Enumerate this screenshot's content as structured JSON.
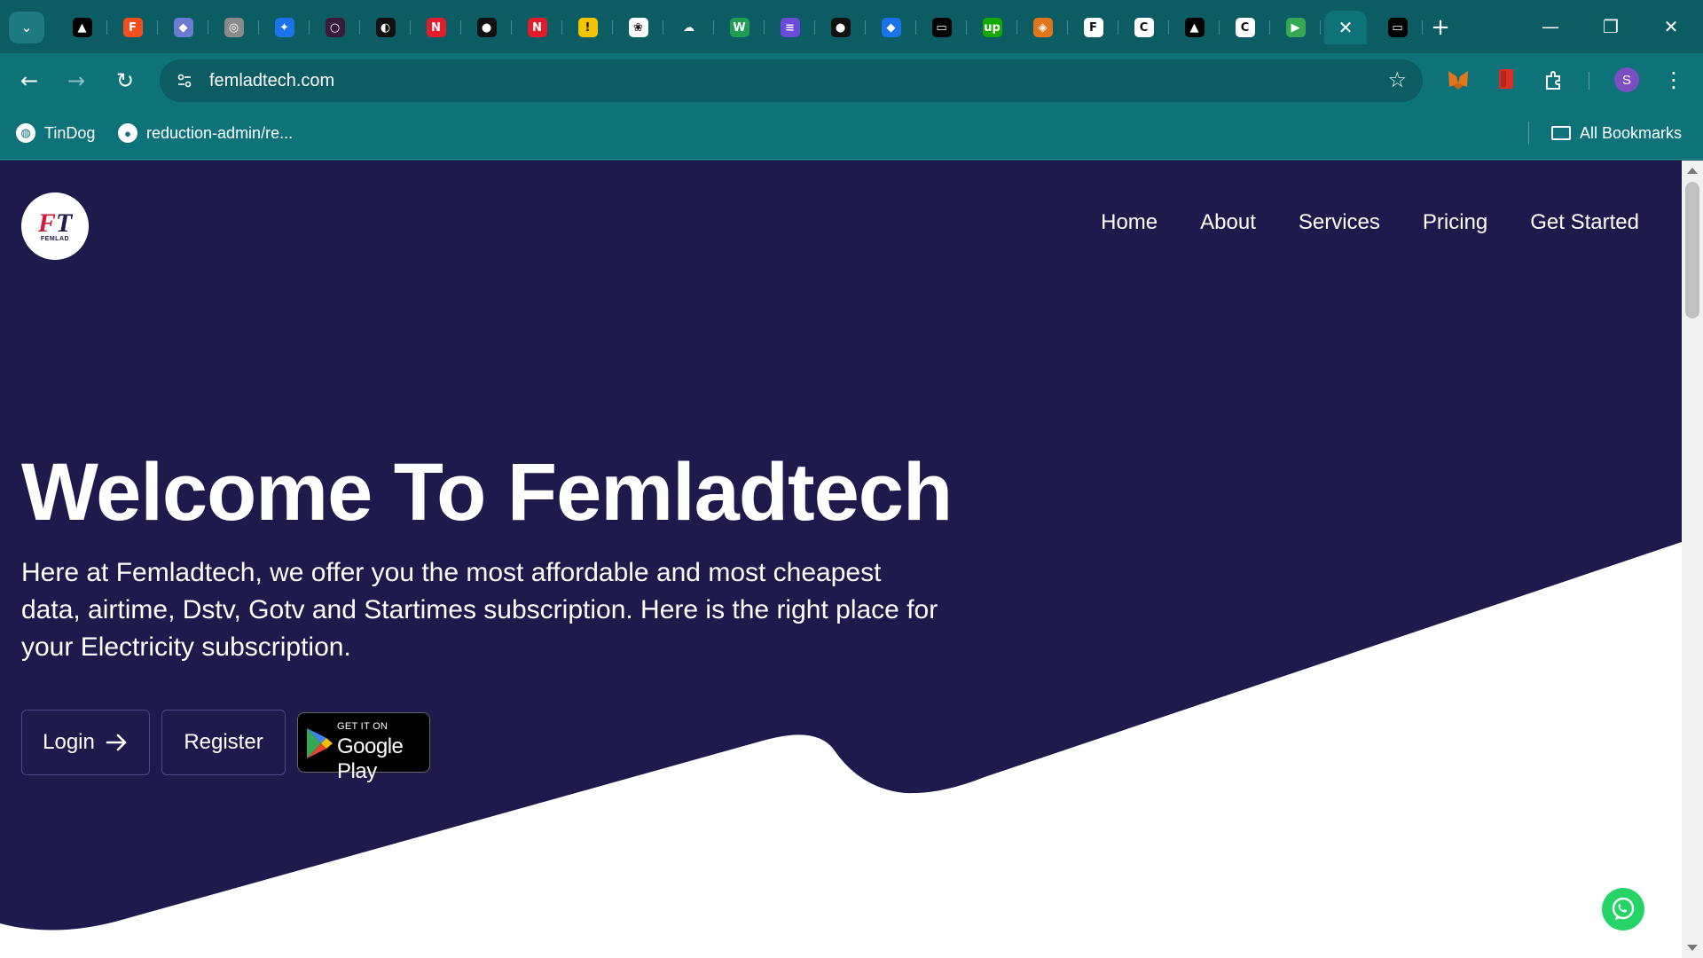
{
  "browser": {
    "tabs": [
      {
        "icon": "vercel-icon",
        "color": "#000000",
        "glyph": "▲"
      },
      {
        "icon": "figma-icon",
        "color": "#f24e1e",
        "glyph": "F"
      },
      {
        "icon": "ethereum-icon",
        "color": "#6a7bd1",
        "glyph": "◆"
      },
      {
        "icon": "globe-icon",
        "color": "#8a8a8a",
        "glyph": "◎"
      },
      {
        "icon": "sparkle-icon",
        "color": "#1a73e8",
        "glyph": "✦"
      },
      {
        "icon": "github-dark-icon",
        "color": "#3a1a3a",
        "glyph": "○"
      },
      {
        "icon": "chart-icon",
        "color": "#111111",
        "glyph": "◐"
      },
      {
        "icon": "n-red-icon",
        "color": "#e11d2b",
        "glyph": "N"
      },
      {
        "icon": "github-icon",
        "color": "#111111",
        "glyph": "●"
      },
      {
        "icon": "n-red-icon",
        "color": "#e11d2b",
        "glyph": "N"
      },
      {
        "icon": "warning-icon",
        "color": "#f5c400",
        "glyph": "!"
      },
      {
        "icon": "openai-icon",
        "color": "#ffffff",
        "glyph": "❀"
      },
      {
        "icon": "cloud-icon",
        "color": "#0b5c63",
        "glyph": "☁"
      },
      {
        "icon": "webflow-icon",
        "color": "#1f9d55",
        "glyph": "W"
      },
      {
        "icon": "list-icon",
        "color": "#6d4bd8",
        "glyph": "≡"
      },
      {
        "icon": "github-icon",
        "color": "#111111",
        "glyph": "●"
      },
      {
        "icon": "diamond-icon",
        "color": "#1a73e8",
        "glyph": "◆"
      },
      {
        "icon": "terminal-icon",
        "color": "#000000",
        "glyph": "▭"
      },
      {
        "icon": "upwork-icon",
        "color": "#14a800",
        "glyph": "up"
      },
      {
        "icon": "metamask-icon",
        "color": "#e2761b",
        "glyph": "◈"
      },
      {
        "icon": "femlad-icon",
        "color": "#ffffff",
        "glyph": "F"
      },
      {
        "icon": "c-circle-icon",
        "color": "#ffffff",
        "glyph": "C"
      },
      {
        "icon": "vercel-icon",
        "color": "#000000",
        "glyph": "▲"
      },
      {
        "icon": "c-circle-icon",
        "color": "#ffffff",
        "glyph": "C"
      },
      {
        "icon": "google-play-icon",
        "color": "#34a853",
        "glyph": "▶"
      }
    ],
    "active_tab_close": "✕",
    "extra_tab": {
      "icon": "terminal-icon",
      "color": "#000000",
      "glyph": "▭"
    },
    "new_tab": "+",
    "url": "femladtech.com",
    "profile_initial": "S",
    "bookmarks": [
      {
        "label": "TinDog",
        "icon": "globe-icon"
      },
      {
        "label": "reduction-admin/re...",
        "icon": "github-icon"
      }
    ],
    "all_bookmarks": "All Bookmarks"
  },
  "page": {
    "colors": {
      "background": "#1e1a4c",
      "wave": "#ffffff"
    },
    "logo": {
      "mark_a": "F",
      "mark_b": "T",
      "text": "FEMLAD"
    },
    "nav": [
      "Home",
      "About",
      "Services",
      "Pricing",
      "Get Started"
    ],
    "hero": {
      "title": "Welcome To Femladtech",
      "text": "Here at Femladtech, we offer you the most affordable and most cheapest data, airtime, Dstv, Gotv and Startimes subscription. Here is the right place for your Electricity subscription."
    },
    "buttons": {
      "login": "Login",
      "register": "Register"
    },
    "google_play": {
      "small": "GET IT ON",
      "big": "Google Play"
    }
  }
}
